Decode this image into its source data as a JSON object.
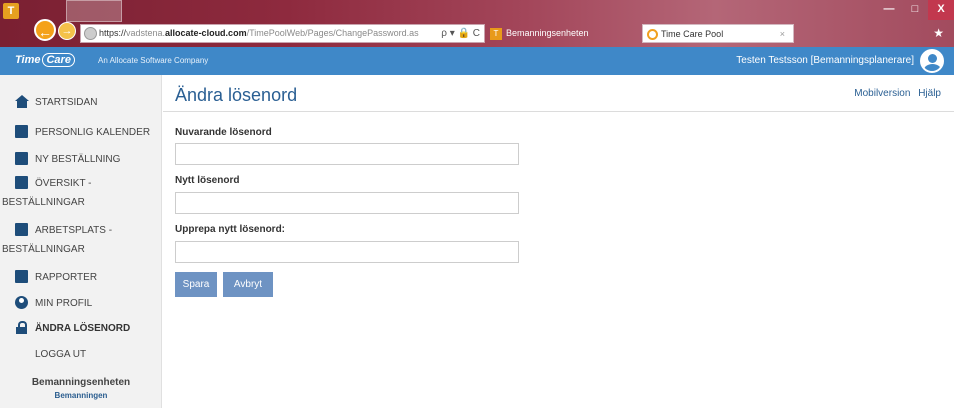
{
  "browser": {
    "url_scheme": "https://",
    "url_sub": "vadstena.",
    "url_domain": "allocate-cloud.com",
    "url_path": "/TimePoolWeb/Pages/ChangePassword.as",
    "url_controls": "ρ ▾ 🔒 C",
    "tabs": [
      {
        "label": "Bemanningsenheten"
      },
      {
        "label": "Time Care Pool",
        "close": "×"
      }
    ],
    "window_controls": {
      "minimize": "—",
      "maximize": "□",
      "close": "X"
    },
    "favorites_glyph": "★"
  },
  "app": {
    "logo_time": "Time",
    "logo_care": "Care",
    "company": "An Allocate Software Company",
    "user": "Testen Testsson [Bemanningsplanerare]"
  },
  "sidebar": {
    "items": [
      {
        "label": "STARTSIDAN",
        "icon": "home-icon"
      },
      {
        "label": "PERSONLIG KALENDER",
        "icon": "calendar-icon"
      },
      {
        "label": "NY BESTÄLLNING",
        "icon": "document-icon"
      },
      {
        "label": "ÖVERSIKT -",
        "label2": "BESTÄLLNINGAR",
        "icon": "document-icon"
      },
      {
        "label": "ARBETSPLATS -",
        "label2": "BESTÄLLNINGAR",
        "icon": "document-icon"
      },
      {
        "label": "RAPPORTER",
        "icon": "report-icon"
      },
      {
        "label": "MIN PROFIL",
        "icon": "person-icon"
      },
      {
        "label": "ÄNDRA LÖSENORD",
        "icon": "lock-icon",
        "active": true
      },
      {
        "label": "LOGGA UT"
      }
    ],
    "unit_name": "Bemanningsenheten",
    "unit_sub": "Bemanningen"
  },
  "main": {
    "title": "Ändra lösenord",
    "links": {
      "mobile": "Mobilversion",
      "help": "Hjälp"
    },
    "fields": [
      {
        "label": "Nuvarande lösenord",
        "value": ""
      },
      {
        "label": "Nytt lösenord",
        "value": ""
      },
      {
        "label": "Upprepa nytt lösenord:",
        "value": ""
      }
    ],
    "buttons": {
      "save": "Spara",
      "cancel": "Avbryt"
    }
  }
}
